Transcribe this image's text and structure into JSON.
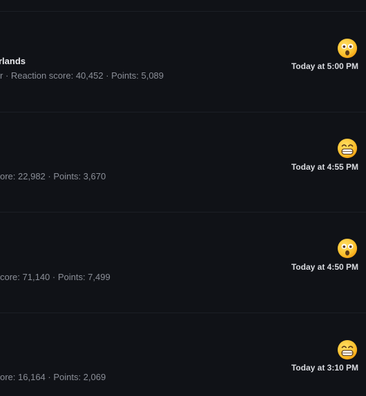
{
  "reactions": [
    {
      "name": "rlands",
      "stats": "r · Reaction score: 40,452 · Points: 5,089",
      "reaction_icon": "astonished-face-emoji",
      "time": "Today at 5:00 PM"
    },
    {
      "name": "",
      "stats": "ore: 22,982 · Points: 3,670",
      "reaction_icon": "grinning-face-emoji",
      "time": "Today at 4:55 PM"
    },
    {
      "name": "",
      "stats": "core: 71,140 · Points: 7,499",
      "reaction_icon": "astonished-face-emoji",
      "time": "Today at 4:50 PM"
    },
    {
      "name": "",
      "stats": "ore: 16,164 · Points: 2,069",
      "reaction_icon": "grinning-face-emoji",
      "time": "Today at 3:10 PM"
    }
  ],
  "colors": {
    "background": "#101217",
    "divider": "#1c1f26",
    "emoji_yellow": "#fbc02d"
  }
}
